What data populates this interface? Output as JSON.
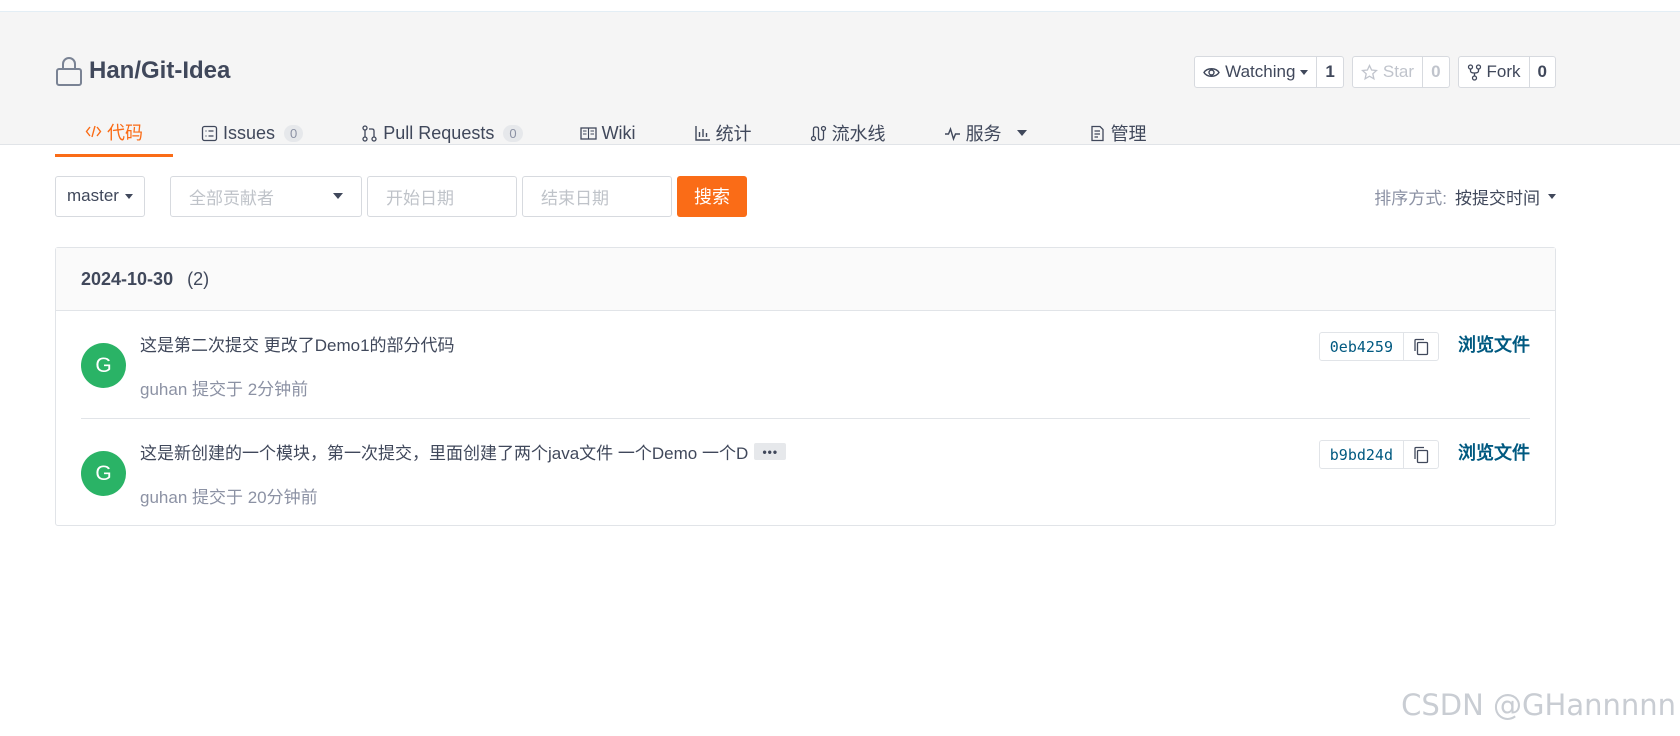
{
  "repo": {
    "title": "Han/Git-Idea"
  },
  "actions": {
    "watch": {
      "label": "Watching",
      "count": "1"
    },
    "star": {
      "label": "Star",
      "count": "0"
    },
    "fork": {
      "label": "Fork",
      "count": "0"
    }
  },
  "tabs": [
    {
      "label": "代码",
      "icon": "code-icon",
      "active": true
    },
    {
      "label": "Issues",
      "badge": "0",
      "icon": "issues-icon"
    },
    {
      "label": "Pull Requests",
      "badge": "0",
      "icon": "pull-request-icon"
    },
    {
      "label": "Wiki",
      "icon": "wiki-icon"
    },
    {
      "label": "统计",
      "icon": "bar-chart-icon"
    },
    {
      "label": "流水线",
      "icon": "pipeline-icon"
    },
    {
      "label": "服务",
      "icon": "pulse-icon"
    },
    {
      "label": "管理",
      "icon": "manage-icon"
    }
  ],
  "filters": {
    "branch": "master",
    "contributor_placeholder": "全部贡献者",
    "start_placeholder": "开始日期",
    "end_placeholder": "结束日期",
    "search_label": "搜索"
  },
  "sort": {
    "label": "排序方式:",
    "value": "按提交时间"
  },
  "commits": {
    "date": "2024-10-30",
    "count": "(2)",
    "items": [
      {
        "avatar": "G",
        "message": "这是第二次提交 更改了Demo1的部分代码",
        "meta": "guhan 提交于 2分钟前",
        "sha": "0eb4259",
        "browse": "浏览文件"
      },
      {
        "avatar": "G",
        "message": "这是新创建的一个模块，第一次提交，里面创建了两个java文件 一个Demo 一个D",
        "more": "•••",
        "meta": "guhan 提交于 20分钟前",
        "sha": "b9bd24d",
        "browse": "浏览文件"
      }
    ]
  },
  "watermark": "CSDN @GHannnnn",
  "colors": {
    "accent": "#fa6c17",
    "link": "#005980",
    "avatar": "#2ab366"
  }
}
